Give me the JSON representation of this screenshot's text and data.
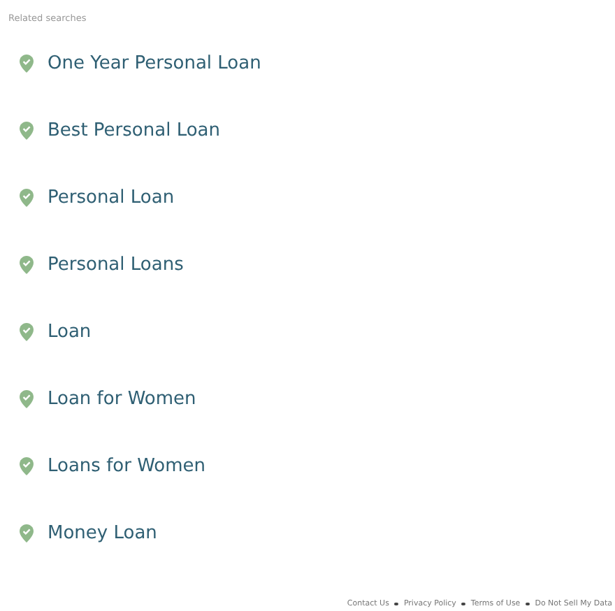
{
  "heading": "Related searches",
  "searches": [
    "One Year Personal Loan",
    "Best Personal Loan",
    "Personal Loan",
    "Personal Loans",
    "Loan",
    "Loan for Women",
    "Loans for Women",
    "Money Loan"
  ],
  "footer_links": [
    "Contact Us",
    "Privacy Policy",
    "Terms of Use",
    "Do Not Sell My Data"
  ]
}
